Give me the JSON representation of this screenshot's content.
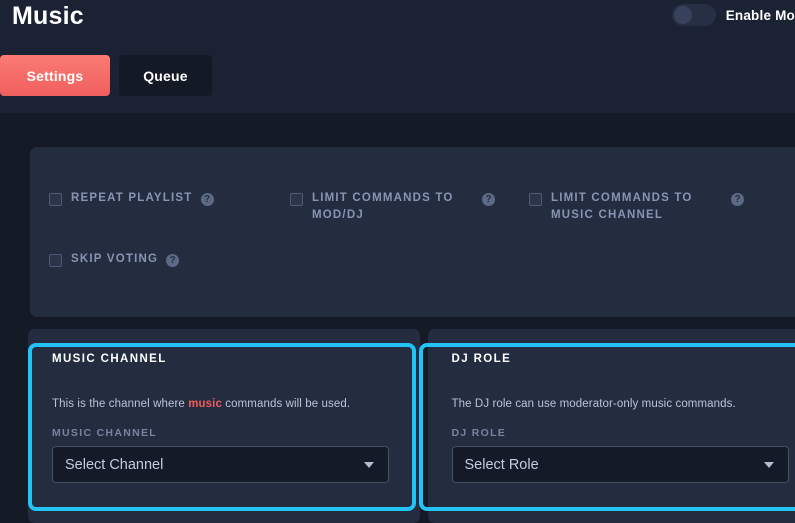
{
  "header": {
    "title": "Music",
    "mod_toggle": {
      "label": "Enable Mo",
      "state": "off",
      "icon": "toggle-off-icon"
    }
  },
  "tabs": [
    {
      "label": "Settings",
      "active": true
    },
    {
      "label": "Queue",
      "active": false
    }
  ],
  "settings_card": {
    "options": [
      {
        "label": "Repeat Playlist",
        "checked": false,
        "help": "?",
        "help_icon": "question-circle-icon"
      },
      {
        "label": "Limit Commands to Mod/DJ",
        "checked": false,
        "help": "?",
        "help_icon": "question-circle-icon"
      },
      {
        "label": "Limit Commands to Music Channel",
        "checked": false,
        "help": "?",
        "help_icon": "question-circle-icon"
      },
      {
        "label": "Skip Voting",
        "checked": false,
        "help": "?",
        "help_icon": "question-circle-icon"
      }
    ]
  },
  "panels": [
    {
      "title": "Music Channel",
      "description_before": "This is the channel where ",
      "description_keyword": "music",
      "description_after": " commands will be used.",
      "field_label": "Music Channel",
      "select_value": "Select Channel",
      "caret_icon": "chevron-down-icon",
      "highlighted": true
    },
    {
      "title": "DJ Role",
      "description_before": "The DJ role can use moderator-only music commands.",
      "description_keyword": "",
      "description_after": "",
      "field_label": "DJ Role",
      "select_value": "Select Role",
      "caret_icon": "chevron-down-icon",
      "highlighted": true
    }
  ],
  "colors": {
    "page_bg": "#151a27",
    "header_bg": "#1b2233",
    "card_bg": "#242d40",
    "accent_coral": "#f05f5f",
    "highlight_cyan": "#23c3f7",
    "keyword_red": "#f15b5b",
    "input_bg": "#141a27"
  }
}
